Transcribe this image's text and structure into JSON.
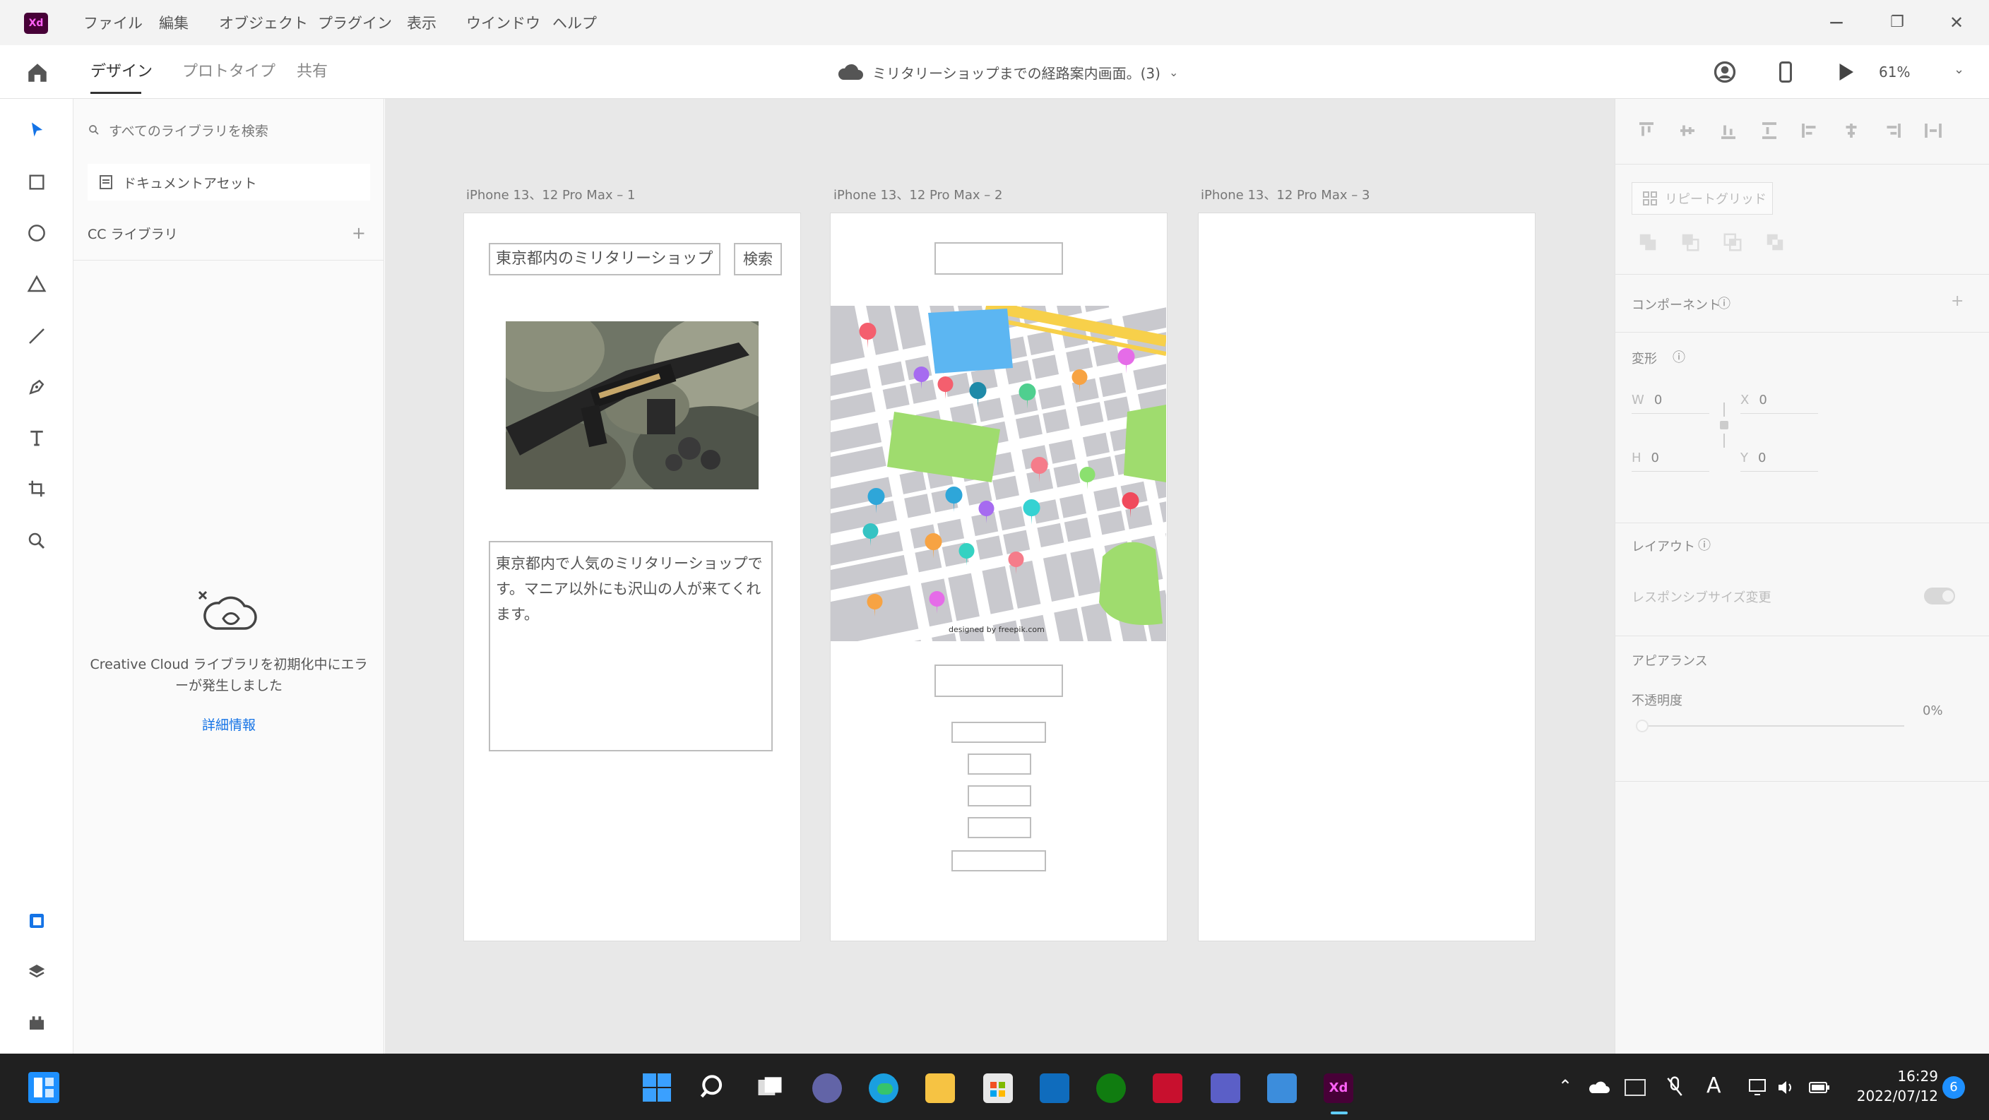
{
  "app": {
    "logo_text": "Xd",
    "menu": [
      "ファイル",
      "編集",
      "オブジェクト",
      "プラグイン",
      "表示",
      "ウインドウ",
      "ヘルプ"
    ],
    "window_controls": [
      "−",
      "❐",
      "✕"
    ]
  },
  "toolbar": {
    "tabs": [
      "デザイン",
      "プロトタイプ",
      "共有"
    ],
    "active_tab": "デザイン",
    "document_title": "ミリタリーショップまでの経路案内画面。(3)",
    "zoom": "61%"
  },
  "left_tools": [
    "select-tool",
    "rectangle-tool",
    "ellipse-tool",
    "polygon-tool",
    "line-tool",
    "pen-tool",
    "text-tool",
    "artboard-tool",
    "zoom-tool"
  ],
  "left_bottom_tools": [
    "assets-icon",
    "layers-icon",
    "plugins-icon"
  ],
  "libraries": {
    "search_placeholder": "すべてのライブラリを検索",
    "document_assets": "ドキュメントアセット",
    "cc_libraries": "CC ライブラリ",
    "add_symbol": "+",
    "error_message": "Creative Cloud ライブラリを初期化中にエラーが発生しました",
    "details_link": "詳細情報"
  },
  "artboards": [
    {
      "label": "iPhone 13、12 Pro Max – 1",
      "search_text": "東京都内のミリタリーショップ",
      "search_button": "検索",
      "description": "東京都内で人気のミリタリーショップです。マニア以外にも沢山の人が来てくれます。"
    },
    {
      "label": "iPhone 13、12 Pro Max – 2",
      "map_credit": "designed by freepik.com"
    },
    {
      "label": "iPhone 13、12 Pro Max – 3"
    }
  ],
  "properties": {
    "repeat_grid": "リピートグリッド",
    "component": "コンポーネント",
    "transform": "変形",
    "w_label": "W",
    "w_value": "0",
    "h_label": "H",
    "h_value": "0",
    "x_label": "X",
    "x_value": "0",
    "y_label": "Y",
    "y_value": "0",
    "layout": "レイアウト",
    "responsive_resize": "レスポンシブサイズ変更",
    "appearance": "アピアランス",
    "opacity_label": "不透明度",
    "opacity_value": "0%",
    "info": "ⓘ",
    "add": "+"
  },
  "taskbar": {
    "apps": [
      "start",
      "search",
      "task-view",
      "teams-chat",
      "edge",
      "file-explorer",
      "store",
      "mail",
      "xbox",
      "app-red",
      "teams",
      "remote-desktop",
      "adobe-xd"
    ],
    "tray_icons": [
      "chevron-up-icon",
      "onedrive-icon",
      "keyboard-icon",
      "mic-muted-icon",
      "ime-icon",
      "network-icon",
      "volume-icon",
      "battery-icon"
    ],
    "ime_label": "A",
    "time": "16:29",
    "date": "2022/07/12",
    "notification_count": "6"
  },
  "colors": {
    "xd_purple": "#470137",
    "xd_pink": "#ff61f6",
    "accent_blue": "#1473e6",
    "taskbar_bg": "#202020",
    "map_green": "#9fdc6e",
    "map_water": "#5cb6f2",
    "map_road_yellow": "#f7d04a"
  }
}
